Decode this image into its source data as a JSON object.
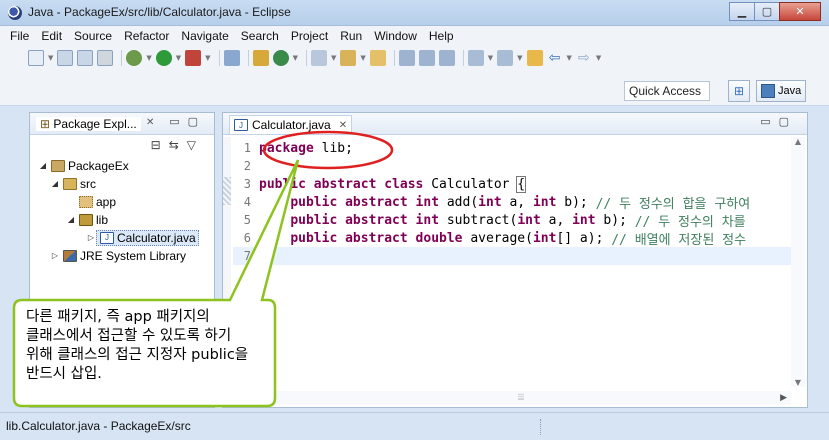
{
  "window": {
    "title": "Java - PackageEx/src/lib/Calculator.java - Eclipse"
  },
  "menu": [
    "File",
    "Edit",
    "Source",
    "Refactor",
    "Navigate",
    "Search",
    "Project",
    "Run",
    "Window",
    "Help"
  ],
  "toolbar": {
    "quick_access": "Quick Access",
    "perspective": "Java"
  },
  "package_explorer": {
    "tab_label": "Package Expl...",
    "tree": [
      {
        "label": "PackageEx",
        "icon": "project-icon"
      },
      {
        "label": "src",
        "icon": "source-folder-icon"
      },
      {
        "label": "app",
        "icon": "empty-package-icon"
      },
      {
        "label": "lib",
        "icon": "package-icon"
      },
      {
        "label": "Calculator.java",
        "icon": "java-file-icon"
      },
      {
        "label": "JRE System Library",
        "icon": "library-icon"
      }
    ]
  },
  "editor": {
    "tab_label": "Calculator.java",
    "lines": [
      {
        "num": "1",
        "text": "package lib;"
      },
      {
        "num": "2",
        "text": ""
      },
      {
        "num": "3",
        "text": "public abstract class Calculator {"
      },
      {
        "num": "4",
        "text": "    public abstract int add(int a, int b); // 두 정수의 합을 구하여"
      },
      {
        "num": "5",
        "text": "    public abstract int subtract(int a, int b); // 두 정수의 차를"
      },
      {
        "num": "6",
        "text": "    public abstract double average(int[] a); // 배열에 저장된 정수"
      },
      {
        "num": "7",
        "text": "}"
      }
    ]
  },
  "status": {
    "text": "lib.Calculator.java - PackageEx/src"
  },
  "callout": {
    "text": "다른 패키지, 즉 app 패키지의 클래스에서 접근할 수 있도록 하기 위해 클래스의 접근 지정자 public을 반드시 삽입.",
    "border_color": "#8dc21f",
    "highlight_color": "#e02020"
  }
}
